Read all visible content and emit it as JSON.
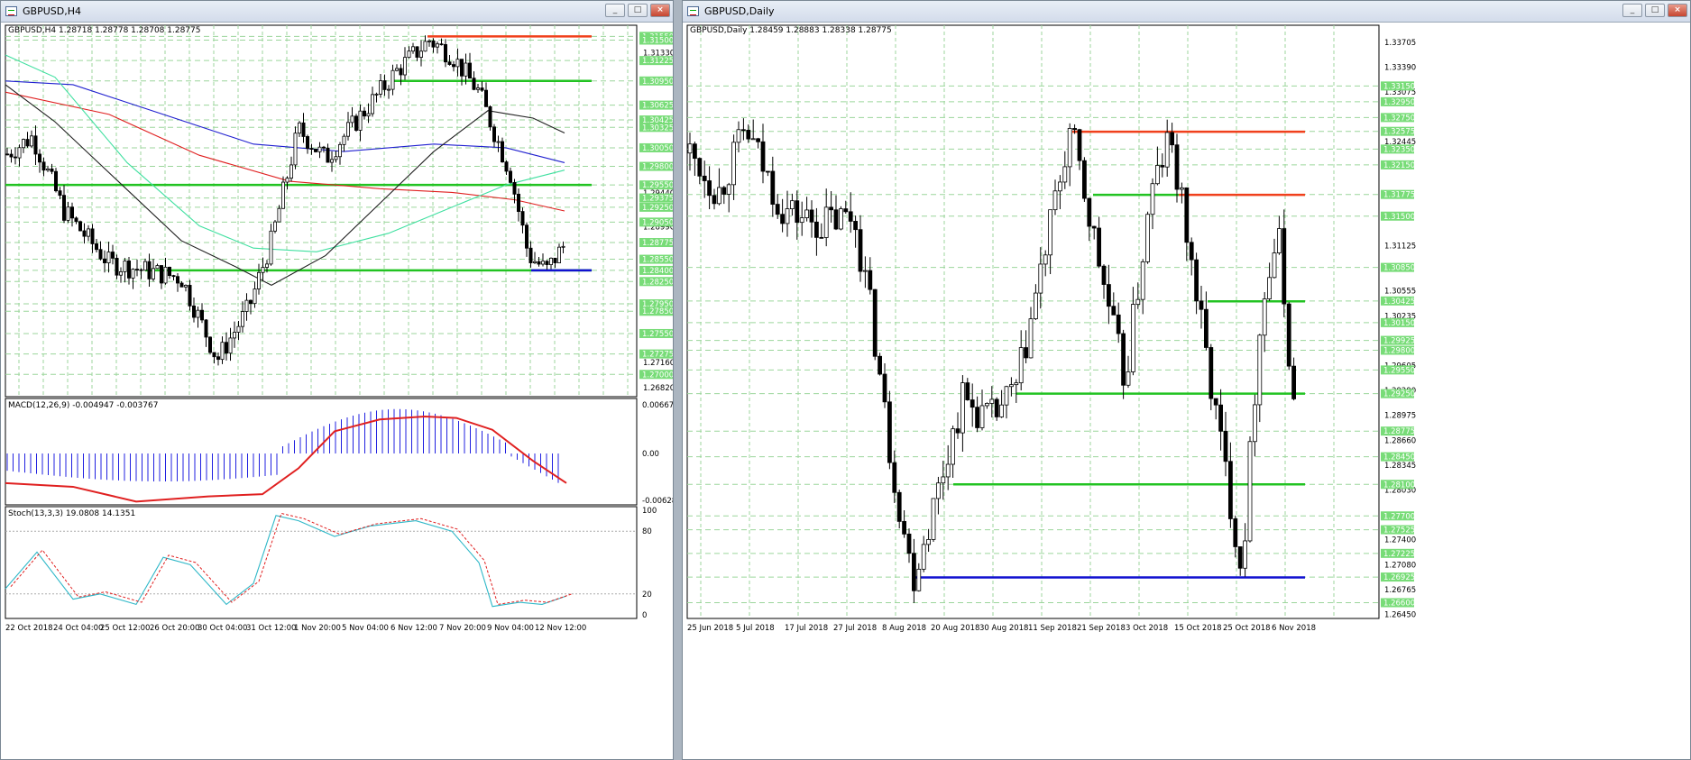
{
  "left_window": {
    "title": "GBPUSD,H4",
    "header": "GBPUSD,H4  1.28718 1.28778 1.28708 1.28775",
    "macd_label": "MACD(12,26,9) -0.004947 -0.003767",
    "stoch_label": "Stoch(13,3,3) 19.0808 14.1351",
    "price_ticks": [
      "1.31330",
      "1.30940",
      "1.29440",
      "1.28990",
      "1.28420",
      "1.27860",
      "1.27160",
      "1.26820"
    ],
    "level_tags": [
      "1.31550",
      "1.31500",
      "1.31225",
      "1.30950",
      "1.30625",
      "1.30425",
      "1.30325",
      "1.30050",
      "1.29800",
      "1.29550",
      "1.29375",
      "1.29250",
      "1.29050",
      "1.28775",
      "1.28550",
      "1.28400",
      "1.28250",
      "1.27950",
      "1.27850",
      "1.27550",
      "1.27275",
      "1.27000"
    ],
    "macd_ticks": [
      "0.006672",
      "0.00",
      "-0.006284"
    ],
    "stoch_ticks": [
      "100",
      "80",
      "20",
      "0"
    ],
    "time_labels": [
      "22 Oct 2018",
      "24 Oct 04:00",
      "25 Oct 12:00",
      "26 Oct 20:00",
      "30 Oct 04:00",
      "31 Oct 12:00",
      "1 Nov 20:00",
      "5 Nov 04:00",
      "6 Nov 12:00",
      "7 Nov 20:00",
      "9 Nov 04:00",
      "12 Nov 12:00"
    ]
  },
  "right_window": {
    "title": "GBPUSD,Daily",
    "header": "GBPUSD,Daily  1.28459 1.28883 1.28338 1.28775",
    "price_ticks": [
      "1.33705",
      "1.33390",
      "1.33075",
      "1.32445",
      "1.31125",
      "1.30555",
      "1.30235",
      "1.29605",
      "1.29290",
      "1.28975",
      "1.28660",
      "1.28345",
      "1.28030",
      "1.27400",
      "1.27080",
      "1.26765",
      "1.26450"
    ],
    "level_tags": [
      "1.33150",
      "1.32950",
      "1.32750",
      "1.32575",
      "1.32350",
      "1.32150",
      "1.31775",
      "1.31500",
      "1.30850",
      "1.30425",
      "1.30150",
      "1.29925",
      "1.29800",
      "1.29550",
      "1.29250",
      "1.28775",
      "1.28450",
      "1.28100",
      "1.27700",
      "1.27525",
      "1.27225",
      "1.26925",
      "1.26600"
    ],
    "time_labels": [
      "25 Jun 2018",
      "5 Jul 2018",
      "17 Jul 2018",
      "27 Jul 2018",
      "8 Aug 2018",
      "20 Aug 2018",
      "30 Aug 2018",
      "11 Sep 2018",
      "21 Sep 2018",
      "3 Oct 2018",
      "15 Oct 2018",
      "25 Oct 2018",
      "6 Nov 2018"
    ]
  },
  "window_buttons": {
    "minimize": "_",
    "maximize": "□",
    "close": "×"
  },
  "colors": {
    "green_level": "#22c322",
    "red_level": "#f0401c",
    "blue_level": "#1010d0",
    "grid": "#9cd69c",
    "ma_red": "#e02020",
    "ma_blue": "#2020d0",
    "ma_cyan": "#40e0a0",
    "ma_black": "#202020",
    "macd_hist": "#2020e0"
  }
}
